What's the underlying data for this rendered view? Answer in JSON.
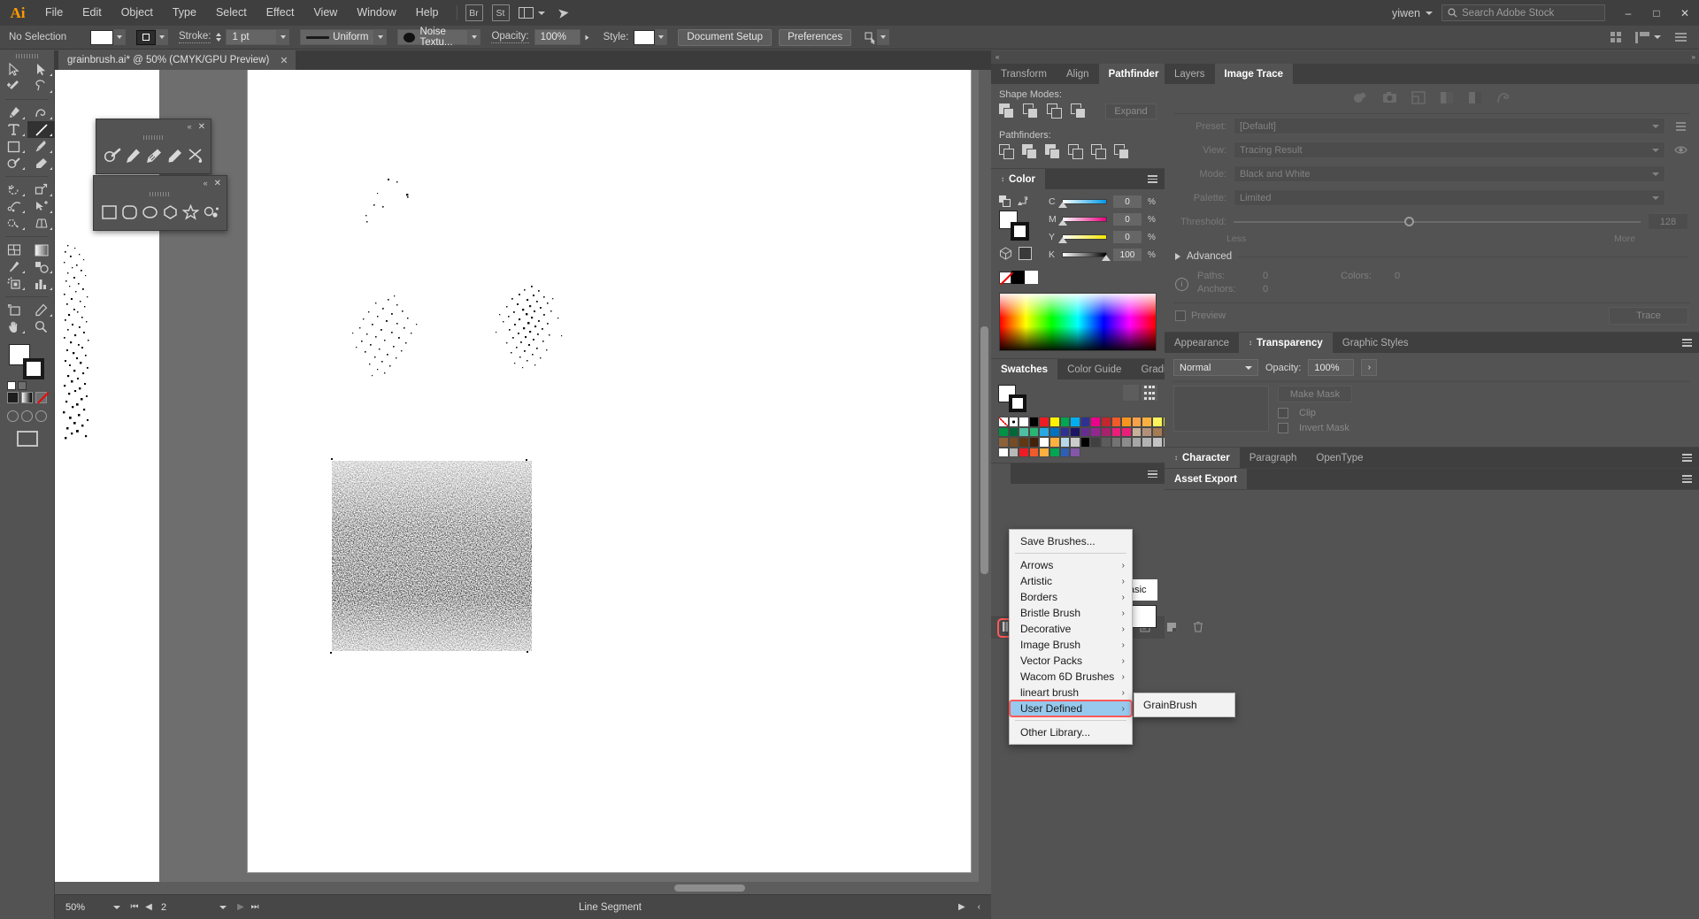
{
  "app": {
    "logo": "Ai",
    "menus": [
      "File",
      "Edit",
      "Object",
      "Type",
      "Select",
      "Effect",
      "View",
      "Window",
      "Help"
    ],
    "bridge_badge": "Br",
    "stock_badge": "St",
    "user": "yiwen",
    "search_placeholder": "Search Adobe Stock",
    "window_buttons": {
      "minimize": "–",
      "maximize": "□",
      "close": "✕"
    }
  },
  "control_bar": {
    "selection_state": "No Selection",
    "stroke_label": "Stroke:",
    "stroke_weight": "1 pt",
    "profile": "Uniform",
    "brush_definition": "Noise Textu...",
    "opacity_label": "Opacity:",
    "opacity_value": "100%",
    "style_label": "Style:",
    "document_setup": "Document Setup",
    "preferences": "Preferences"
  },
  "document": {
    "tab_title": "grainbrush.ai* @ 50% (CMYK/GPU Preview)",
    "close_glyph": "✕"
  },
  "status_bar": {
    "zoom": "50%",
    "page": "2",
    "tool": "Line Segment"
  },
  "float_panels": {
    "brush_tools": {
      "collapse": "«",
      "close": "✕",
      "icons": [
        "shaper-tool-icon",
        "pencil-tool-icon",
        "smooth-tool-icon",
        "eraser-tool-icon",
        "scissors-tool-icon"
      ]
    },
    "shape_tools": {
      "collapse": "«",
      "close": "✕",
      "icons": [
        "rectangle-tool-icon",
        "rounded-rectangle-tool-icon",
        "ellipse-tool-icon",
        "polygon-tool-icon",
        "star-tool-icon",
        "flare-tool-icon"
      ]
    }
  },
  "pathfinder_panel": {
    "tabs": [
      "Transform",
      "Align",
      "Pathfinder"
    ],
    "active_tab": "Pathfinder",
    "shape_modes_label": "Shape Modes:",
    "pathfinders_label": "Pathfinders:",
    "expand_label": "Expand"
  },
  "color_panel": {
    "title": "Color",
    "channels": [
      {
        "name": "C",
        "value": "0",
        "unit": "%",
        "pos": 0
      },
      {
        "name": "M",
        "value": "0",
        "unit": "%",
        "pos": 0
      },
      {
        "name": "Y",
        "value": "0",
        "unit": "%",
        "pos": 0
      },
      {
        "name": "K",
        "value": "100",
        "unit": "%",
        "pos": 100
      }
    ]
  },
  "swatches_panel": {
    "tabs": [
      "Swatches",
      "Color Guide",
      "Gradient"
    ],
    "active_tab": "Swatches",
    "colors": [
      "none",
      "registration",
      "#ffffff",
      "#000000",
      "#ed1c24",
      "#fff200",
      "#00a651",
      "#00aeef",
      "#2e3192",
      "#ec008c",
      "#c1272d",
      "#f15a29",
      "#f7941e",
      "#f9a14a",
      "#fbb040",
      "#fff45b",
      "#d7df23",
      "#8dc63f",
      "#39b54a",
      "#009245",
      "#006837",
      "#4fbfa3",
      "#2bb673",
      "#27aae1",
      "#0071bc",
      "#2e3192",
      "#1b1464",
      "#662d91",
      "#92278f",
      "#a8216b",
      "#ec1e79",
      "#ed1e79",
      "#c7b299",
      "#b2907a",
      "#a67c52",
      "#754c24",
      "#c69c6d",
      "#b07b43",
      "#8c6239",
      "#754c24",
      "#603813",
      "#42210b",
      "#ffffff",
      "#fbb040",
      "#b8d8e8",
      "#cccccc",
      "#000000",
      "#404040",
      "#5c5c5c",
      "#737373",
      "#8c8c8c",
      "#a6a6a6",
      "#b3b3b3",
      "#c4c4c4",
      "#d4d4d4",
      "#e6e6e6",
      "#f2f2f2",
      "#ffffff",
      "#b8b8b8",
      "#ed1c24",
      "#f15a29",
      "#fbb040",
      "#00a651",
      "#2e5fb5",
      "#8456a8"
    ]
  },
  "image_trace_panel": {
    "tabs": [
      "Layers",
      "Image Trace"
    ],
    "active_tab": "Image Trace",
    "preset_label": "Preset:",
    "preset_value": "[Default]",
    "view_label": "View:",
    "view_value": "Tracing Result",
    "mode_label": "Mode:",
    "mode_value": "Black and White",
    "palette_label": "Palette:",
    "palette_value": "Limited",
    "threshold_label": "Threshold:",
    "threshold_value": "128",
    "less_label": "Less",
    "more_label": "More",
    "advanced_label": "Advanced",
    "paths_label": "Paths:",
    "paths_value": "0",
    "colors_label": "Colors:",
    "colors_value": "0",
    "anchors_label": "Anchors:",
    "anchors_value": "0",
    "preview_label": "Preview",
    "trace_label": "Trace"
  },
  "transparency_panel": {
    "tabs": [
      "Appearance",
      "Transparency",
      "Graphic Styles"
    ],
    "active_tab": "Transparency",
    "blend_mode": "Normal",
    "opacity_label": "Opacity:",
    "opacity_value": "100%",
    "make_mask": "Make Mask",
    "clip_label": "Clip",
    "invert_mask_label": "Invert Mask"
  },
  "character_panel": {
    "tabs": [
      "Character",
      "Paragraph",
      "OpenType"
    ],
    "active_tab": "Character"
  },
  "asset_export_panel": {
    "title": "Asset Export"
  },
  "brushes_panel": {
    "visible_item_label": "asic"
  },
  "brush_library_menu": {
    "header_item": "Save Brushes...",
    "items": [
      {
        "label": "Arrows",
        "submenu": true
      },
      {
        "label": "Artistic",
        "submenu": true
      },
      {
        "label": "Borders",
        "submenu": true
      },
      {
        "label": "Bristle Brush",
        "submenu": true
      },
      {
        "label": "Decorative",
        "submenu": true
      },
      {
        "label": "Image Brush",
        "submenu": true
      },
      {
        "label": "Vector Packs",
        "submenu": true
      },
      {
        "label": "Wacom 6D Brushes",
        "submenu": true
      },
      {
        "label": "lineart brush",
        "submenu": true
      },
      {
        "label": "User Defined",
        "submenu": true,
        "highlighted": true
      }
    ],
    "footer_item": "Other Library...",
    "arrow_glyph": "›",
    "submenu_items": [
      "GrainBrush"
    ],
    "highlight_color": "#ff5a5a",
    "selection_color": "#96c9ed"
  },
  "tools": [
    "selection-tool",
    "direct-selection-tool",
    "magic-wand-tool",
    "lasso-tool",
    "pen-tool",
    "curvature-tool",
    "type-tool",
    "line-segment-tool",
    "rectangle-tool",
    "paintbrush-tool",
    "shaper-tool",
    "eraser-tool",
    "rotate-tool",
    "scale-tool",
    "width-tool",
    "free-transform-tool",
    "shape-builder-tool",
    "perspective-grid-tool",
    "mesh-tool",
    "gradient-tool",
    "eyedropper-tool",
    "blend-tool",
    "symbol-sprayer-tool",
    "column-graph-tool",
    "artboard-tool",
    "slice-tool",
    "hand-tool",
    "zoom-tool"
  ]
}
